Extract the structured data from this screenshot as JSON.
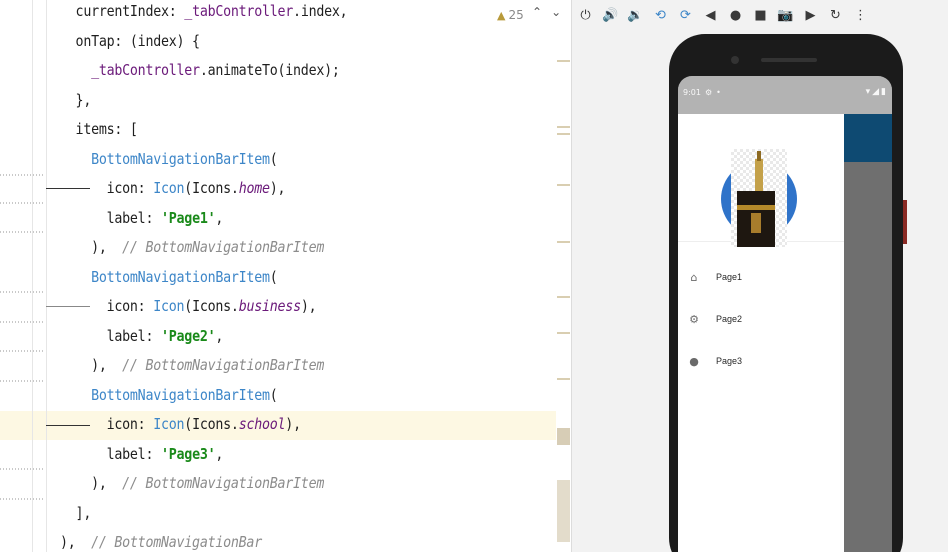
{
  "editor": {
    "lines": [
      {
        "indent": "  ",
        "parts": [
          {
            "t": "currentIndex: ",
            "c": "t-plain"
          },
          {
            "t": "_tabController",
            "c": "t-field"
          },
          {
            "t": ".index,",
            "c": "t-plain"
          }
        ]
      },
      {
        "indent": "  ",
        "parts": [
          {
            "t": "onTap: (index) {",
            "c": "t-plain"
          }
        ]
      },
      {
        "indent": "    ",
        "parts": [
          {
            "t": "_tabController",
            "c": "t-field"
          },
          {
            "t": ".animateTo(index);",
            "c": "t-plain"
          }
        ]
      },
      {
        "indent": "  ",
        "parts": [
          {
            "t": "},",
            "c": "t-plain"
          }
        ]
      },
      {
        "indent": "  ",
        "parts": [
          {
            "t": "items: [",
            "c": "t-plain"
          }
        ]
      },
      {
        "indent": "    ",
        "parts": [
          {
            "t": "BottomNavigationBarItem",
            "c": "t-class"
          },
          {
            "t": "(",
            "c": "t-plain"
          }
        ]
      },
      {
        "indent": "      ",
        "parts": [
          {
            "t": "icon: ",
            "c": "t-plain"
          },
          {
            "t": "Icon",
            "c": "t-class"
          },
          {
            "t": "(Icons.",
            "c": "t-plain"
          },
          {
            "t": "home",
            "c": "t-italic"
          },
          {
            "t": "),",
            "c": "t-plain"
          }
        ]
      },
      {
        "indent": "      ",
        "parts": [
          {
            "t": "label: ",
            "c": "t-plain"
          },
          {
            "t": "'Page1'",
            "c": "t-string"
          },
          {
            "t": ",",
            "c": "t-plain"
          }
        ]
      },
      {
        "indent": "    ",
        "parts": [
          {
            "t": "),  ",
            "c": "t-plain"
          },
          {
            "t": "// BottomNavigationBarItem",
            "c": "t-comment"
          }
        ]
      },
      {
        "indent": "    ",
        "parts": [
          {
            "t": "BottomNavigationBarItem",
            "c": "t-class"
          },
          {
            "t": "(",
            "c": "t-plain"
          }
        ]
      },
      {
        "indent": "      ",
        "parts": [
          {
            "t": "icon: ",
            "c": "t-plain"
          },
          {
            "t": "Icon",
            "c": "t-class"
          },
          {
            "t": "(Icons.",
            "c": "t-plain"
          },
          {
            "t": "business",
            "c": "t-italic"
          },
          {
            "t": "),",
            "c": "t-plain"
          }
        ]
      },
      {
        "indent": "      ",
        "parts": [
          {
            "t": "label: ",
            "c": "t-plain"
          },
          {
            "t": "'Page2'",
            "c": "t-string"
          },
          {
            "t": ",",
            "c": "t-plain"
          }
        ]
      },
      {
        "indent": "    ",
        "parts": [
          {
            "t": "),  ",
            "c": "t-plain"
          },
          {
            "t": "// BottomNavigationBarItem",
            "c": "t-comment"
          }
        ]
      },
      {
        "indent": "    ",
        "parts": [
          {
            "t": "BottomNavigationBarItem",
            "c": "t-class"
          },
          {
            "t": "(",
            "c": "t-plain"
          }
        ]
      },
      {
        "indent": "      ",
        "parts": [
          {
            "t": "icon: ",
            "c": "t-plain"
          },
          {
            "t": "Icon",
            "c": "t-class"
          },
          {
            "t": "(Icons.",
            "c": "t-plain"
          },
          {
            "t": "school",
            "c": "t-italic"
          },
          {
            "t": "),",
            "c": "t-plain"
          }
        ]
      },
      {
        "indent": "      ",
        "parts": [
          {
            "t": "label: ",
            "c": "t-plain"
          },
          {
            "t": "'Page3'",
            "c": "t-string"
          },
          {
            "t": ",",
            "c": "t-plain"
          }
        ]
      },
      {
        "indent": "    ",
        "parts": [
          {
            "t": "),  ",
            "c": "t-plain"
          },
          {
            "t": "// BottomNavigationBarItem",
            "c": "t-comment"
          }
        ]
      },
      {
        "indent": "  ",
        "parts": [
          {
            "t": "],",
            "c": "t-plain"
          }
        ]
      },
      {
        "indent": "",
        "parts": [
          {
            "t": "),  ",
            "c": "t-plain"
          },
          {
            "t": "// BottomNavigationBar",
            "c": "t-comment"
          }
        ]
      }
    ],
    "warning_count": "25",
    "warning_icon": "warning-triangle-icon"
  },
  "emulator": {
    "toolbar": [
      {
        "name": "power-icon",
        "glyph": "⏻"
      },
      {
        "name": "volume-up-icon",
        "glyph": "🔊"
      },
      {
        "name": "volume-down-icon",
        "glyph": "🔉"
      },
      {
        "name": "rotate-left-icon",
        "glyph": "⟲"
      },
      {
        "name": "rotate-right-icon",
        "glyph": "⟳"
      },
      {
        "name": "back-icon",
        "glyph": "◀"
      },
      {
        "name": "home-icon",
        "glyph": "●"
      },
      {
        "name": "overview-icon",
        "glyph": "■"
      },
      {
        "name": "screenshot-icon",
        "glyph": "📷"
      },
      {
        "name": "screen-record-icon",
        "glyph": "▶"
      },
      {
        "name": "snapshot-icon",
        "glyph": "↻"
      },
      {
        "name": "more-options-icon",
        "glyph": "⋮"
      }
    ],
    "status_bar": {
      "time": "9:01"
    },
    "drawer_items": [
      {
        "name": "home-icon",
        "glyph": "⌂",
        "label": "Page1"
      },
      {
        "name": "settings-icon",
        "glyph": "⚙",
        "label": "Page2"
      },
      {
        "name": "person-icon",
        "glyph": "●",
        "label": "Page3"
      }
    ],
    "colors": {
      "app_bar": "#0e4a72",
      "avatar_ring": "#2f73c9",
      "scrim": "#6f6f6f"
    }
  }
}
